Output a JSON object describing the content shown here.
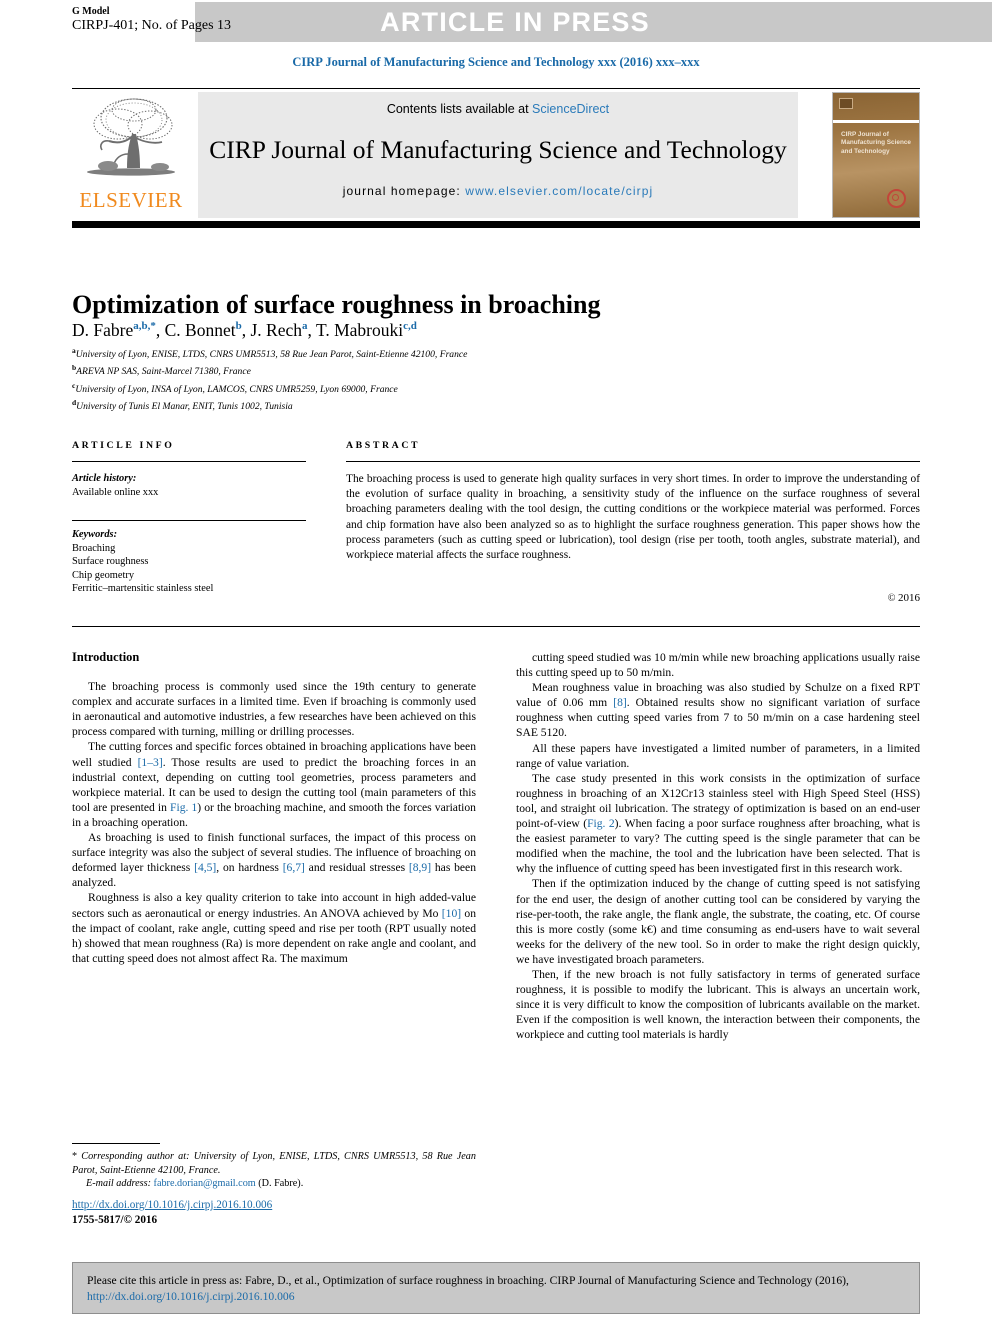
{
  "topbar": {
    "g_model_label": "G Model",
    "manuscript_id": "CIRPJ-401; No. of Pages 13",
    "status_banner": "ARTICLE IN PRESS"
  },
  "journal_ref": "CIRP Journal of Manufacturing Science and Technology xxx (2016) xxx–xxx",
  "masthead": {
    "contents_prefix": "Contents lists available at ",
    "contents_link": "ScienceDirect",
    "journal_title": "CIRP Journal of Manufacturing Science and Technology",
    "homepage_prefix": "journal homepage: ",
    "homepage_link": "www.elsevier.com/locate/cirpj",
    "publisher": "ELSEVIER",
    "publisher_color": "#f08a1e",
    "cover_title": "CIRP Journal of Manufacturing Science and Technology"
  },
  "article": {
    "title": "Optimization of surface roughness in broaching",
    "authors": [
      {
        "name": "D. Fabre",
        "marks": "a,b,*"
      },
      {
        "name": "C. Bonnet",
        "marks": "b"
      },
      {
        "name": "J. Rech",
        "marks": "a"
      },
      {
        "name": "T. Mabrouki",
        "marks": "c,d"
      }
    ],
    "affiliations": [
      {
        "mark": "a",
        "text": "University of Lyon, ENISE, LTDS, CNRS UMR5513, 58 Rue Jean Parot, Saint-Etienne 42100, France"
      },
      {
        "mark": "b",
        "text": "AREVA NP SAS, Saint-Marcel 71380, France"
      },
      {
        "mark": "c",
        "text": "University of Lyon, INSA of Lyon, LAMCOS, CNRS UMR5259, Lyon 69000, France"
      },
      {
        "mark": "d",
        "text": "University of Tunis El Manar, ENIT, Tunis 1002, Tunisia"
      }
    ]
  },
  "article_info": {
    "heading": "ARTICLE INFO",
    "history_label": "Article history:",
    "history_value": "Available online xxx",
    "keywords_label": "Keywords:",
    "keywords": [
      "Broaching",
      "Surface roughness",
      "Chip geometry",
      "Ferritic–martensitic stainless steel"
    ]
  },
  "abstract": {
    "heading": "ABSTRACT",
    "text": "The broaching process is used to generate high quality surfaces in very short times. In order to improve the understanding of the evolution of surface quality in broaching, a sensitivity study of the influence on the surface roughness of several broaching parameters dealing with the tool design, the cutting conditions or the workpiece material was performed. Forces and chip formation have also been analyzed so as to highlight the surface roughness generation. This paper shows how the process parameters (such as cutting speed or lubrication), tool design (rise per tooth, tooth angles, substrate material), and workpiece material affects the surface roughness.",
    "copyright": "2016"
  },
  "body": {
    "section_heading": "Introduction",
    "left_paragraphs": [
      "The broaching process is commonly used since the 19th century to generate complex and accurate surfaces in a limited time. Even if broaching is commonly used in aeronautical and automotive industries, a few researches have been achieved on this process compared with turning, milling or drilling processes.",
      "The cutting forces and specific forces obtained in broaching applications have been well studied [1–3]. Those results are used to predict the broaching forces in an industrial context, depending on cutting tool geometries, process parameters and workpiece material. It can be used to design the cutting tool (main parameters of this tool are presented in Fig. 1) or the broaching machine, and smooth the forces variation in a broaching operation.",
      "As broaching is used to finish functional surfaces, the impact of this process on surface integrity was also the subject of several studies. The influence of broaching on deformed layer thickness [4,5], on hardness [6,7] and residual stresses [8,9] has been analyzed.",
      "Roughness is also a key quality criterion to take into account in high added-value sectors such as aeronautical or energy industries. An ANOVA achieved by Mo [10] on the impact of coolant, rake angle, cutting speed and rise per tooth (RPT usually noted h) showed that mean roughness (Ra) is more dependent on rake angle and coolant, and that cutting speed does not almost affect Ra. The maximum"
    ],
    "right_paragraphs": [
      "cutting speed studied was 10 m/min while new broaching applications usually raise this cutting speed up to 50 m/min.",
      "Mean roughness value in broaching was also studied by Schulze on a fixed RPT value of 0.06 mm [8]. Obtained results show no significant variation of surface roughness when cutting speed varies from 7 to 50 m/min on a case hardening steel SAE 5120.",
      "All these papers have investigated a limited number of parameters, in a limited range of value variation.",
      "The case study presented in this work consists in the optimization of surface roughness in broaching of an X12Cr13 stainless steel with High Speed Steel (HSS) tool, and straight oil lubrication. The strategy of optimization is based on an end-user point-of-view (Fig. 2). When facing a poor surface roughness after broaching, what is the easiest parameter to vary? The cutting speed is the single parameter that can be modified when the machine, the tool and the lubrication have been selected. That is why the influence of cutting speed has been investigated first in this research work.",
      "Then if the optimization induced by the change of cutting speed is not satisfying for the end user, the design of another cutting tool can be considered by varying the rise-per-tooth, the rake angle, the flank angle, the substrate, the coating, etc. Of course this is more costly (some k€) and time consuming as end-users have to wait several weeks for the delivery of the new tool. So in order to make the right design quickly, we have investigated broach parameters.",
      "Then, if the new broach is not fully satisfactory in terms of generated surface roughness, it is possible to modify the lubricant. This is always an uncertain work, since it is very difficult to know the composition of lubricants available on the market. Even if the composition is well known, the interaction between their components, the workpiece and cutting tool materials is hardly"
    ]
  },
  "footnote": {
    "corresponding": "Corresponding author at: University of Lyon, ENISE, LTDS, CNRS UMR5513, 58 Rue Jean Parot, Saint-Etienne 42100, France.",
    "email_label": "E-mail address:",
    "email": "fabre.dorian@gmail.com",
    "email_owner": "(D. Fabre).",
    "doi_url": "http://dx.doi.org/10.1016/j.cirpj.2016.10.006",
    "issn_line": "1755-5817/© 2016"
  },
  "citation_box": {
    "text_before": "Please cite this article in press as: Fabre, D., et al., Optimization of surface roughness in broaching. CIRP Journal of Manufacturing Science and Technology (2016), ",
    "link": "http://dx.doi.org/10.1016/j.cirpj.2016.10.006"
  },
  "colors": {
    "link": "#1a6aa8",
    "banner_gray": "#c8c8c8",
    "masthead_gray": "#e9e9e9",
    "elsevier_orange": "#f08a1e"
  }
}
